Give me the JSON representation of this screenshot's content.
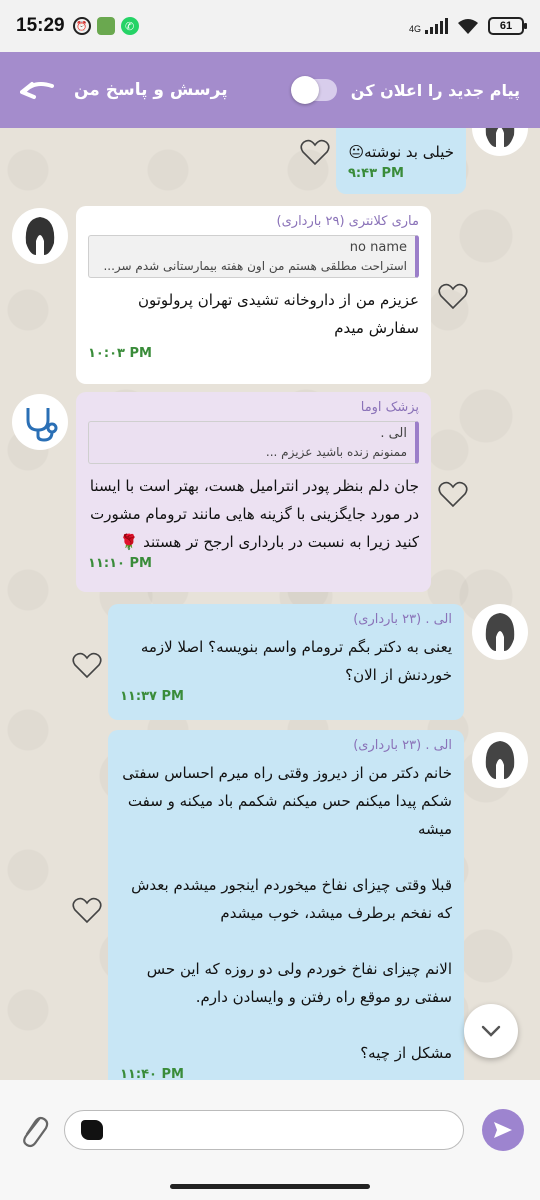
{
  "status_bar": {
    "time": "15:29",
    "battery": "61",
    "signal_label": "4G"
  },
  "header": {
    "title": "پرسش و پاسخ من",
    "notify_label": "پیام جدید را اعلان کن",
    "notify_enabled": false
  },
  "messages": [
    {
      "text": "خیلی بد نوشته😐",
      "time": "۹:۴۳ PM"
    },
    {
      "sender": "ماری کلانتری (۲۹ بارداری)",
      "quote_name": "no name",
      "quote_text": "استراحت مطلقی هستم من اون هفته بیمارستانی شدم سر...",
      "text": "عزیزم من از داروخانه تشیدی تهران پرولوتون سفارش میدم",
      "time": "۱۰:۰۳ PM"
    },
    {
      "sender": "پزشک اوما",
      "quote_name": "الی .",
      "quote_text": "ممنونم زنده باشید عزیزم ...",
      "text": "جان دلم بنظر پودر انترامیل هست، بهتر است با ایسنا در مورد جایگزینی با گزینه هایی مانند ترومام مشورت کنید زیرا به نسبت در بارداری ارجح تر هستند 🌹",
      "time": "۱۱:۱۰ PM"
    },
    {
      "sender": "الی . (۲۳ بارداری)",
      "text": "یعنی به دکتر بگم ترومام واسم بنویسه؟ اصلا لازمه خوردنش از الان؟",
      "time": "۱۱:۳۷ PM"
    },
    {
      "sender": "الی . (۲۳ بارداری)",
      "text": "خانم دکتر من از دیروز وقتی راه میرم احساس سفتی شکم پیدا میکنم حس میکنم شکمم باد میکنه و سفت میشه\n\nقبلا وقتی چیزای نفاخ میخوردم اینجور میشدم بعدش که نفخم برطرف میشد، خوب میشدم\n\nالانم چیزای نفاخ خوردم ولی دو روزه که این حس سفتی رو موقع راه رفتن و وایسادن دارم.\n\nمشکل از چیه؟",
      "time": "۱۱:۴۰ PM"
    }
  ],
  "input": {
    "placeholder": ""
  },
  "icons": {
    "back": "back-arrow-icon",
    "like": "heart-icon",
    "scroll": "chevron-down-icon",
    "attach": "paperclip-icon",
    "send": "send-icon"
  },
  "colors": {
    "header": "#a48ccc",
    "outgoing": "#c8e6f5",
    "incoming": "#ffffff",
    "doctor": "#ece1f2",
    "time": "#3a8c3a"
  }
}
